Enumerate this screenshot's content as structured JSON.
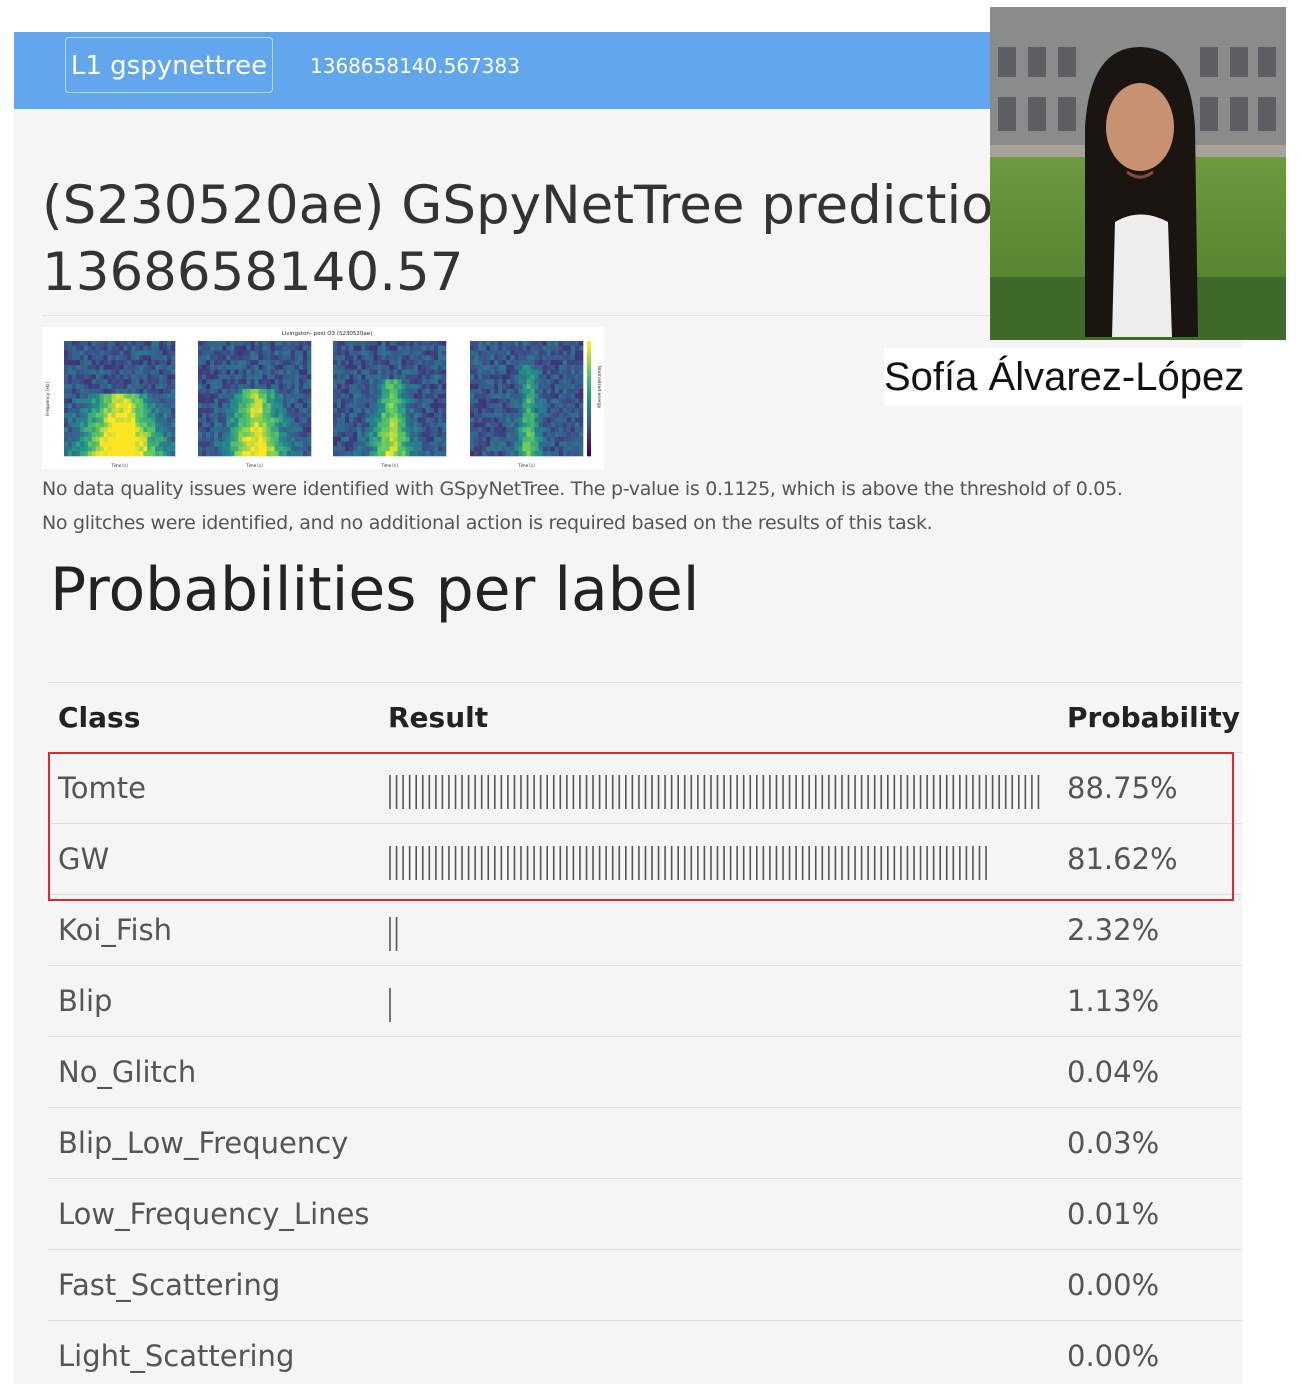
{
  "navbar": {
    "brand": "L1 gspynettree",
    "time": "1368658140.567383"
  },
  "title": "(S230520ae) GSpyNetTree prediction at time 1368658140.57",
  "spectrogram": {
    "title": "Livingston- post O3 (S230520ae)",
    "ylabel": "Frequency [Hz]",
    "colorbar_label": "Normalized energy",
    "xlabel": "Time [s]"
  },
  "paragraphs": [
    "No data quality issues were identified with GSpyNetTree. The p-value is 0.1125, which is above the threshold of 0.05.",
    "No glitches were identified, and no additional action is required based on the results of this task."
  ],
  "subtitle": "Probabilities per label",
  "table": {
    "headers": [
      "Class",
      "Result",
      "Probability"
    ],
    "rows": [
      {
        "label": "Tomte",
        "prob_text": "88.75%",
        "value": 88.75,
        "bars": 100
      },
      {
        "label": "GW",
        "prob_text": "81.62%",
        "value": 81.62,
        "bars": 92
      },
      {
        "label": "Koi_Fish",
        "prob_text": "2.32%",
        "value": 2.32,
        "bars": 2
      },
      {
        "label": "Blip",
        "prob_text": "1.13%",
        "value": 1.13,
        "bars": 1
      },
      {
        "label": "No_Glitch",
        "prob_text": "0.04%",
        "value": 0.04,
        "bars": 0
      },
      {
        "label": "Blip_Low_Frequency",
        "prob_text": "0.03%",
        "value": 0.03,
        "bars": 0
      },
      {
        "label": "Low_Frequency_Lines",
        "prob_text": "0.01%",
        "value": 0.01,
        "bars": 0
      },
      {
        "label": "Fast_Scattering",
        "prob_text": "0.00%",
        "value": 0.0,
        "bars": 0
      },
      {
        "label": "Light_Scattering",
        "prob_text": "0.00%",
        "value": 0.0,
        "bars": 0
      }
    ]
  },
  "person": {
    "name": "Sofía Álvarez-López"
  },
  "colors": {
    "navbar": "#62a6ee",
    "highlight": "#e0262a",
    "viridis_low": "#440154",
    "viridis_mid": "#21918c",
    "viridis_high": "#fde725"
  }
}
